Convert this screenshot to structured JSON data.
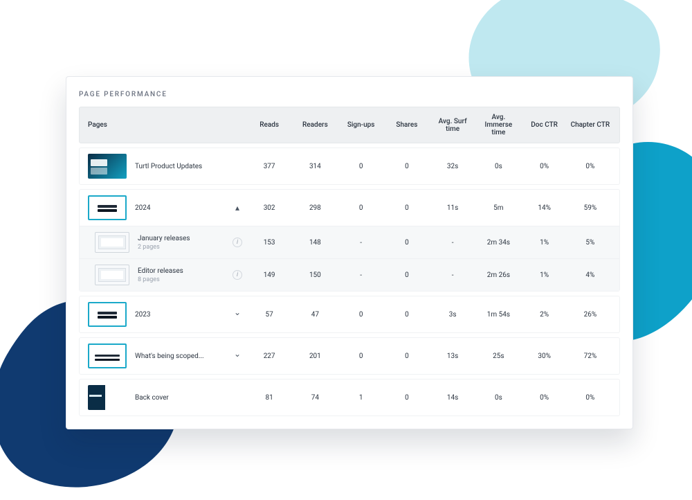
{
  "section_title": "PAGE PERFORMANCE",
  "columns": [
    "Pages",
    "Reads",
    "Readers",
    "Sign-ups",
    "Shares",
    "Avg. Surf time",
    "Avg. Immerse time",
    "Doc CTR",
    "Chapter CTR"
  ],
  "rows": [
    {
      "thumb_class": "cover",
      "title": "Turtl Product Updates",
      "subtitle": "",
      "toggle": "",
      "info": false,
      "vals": [
        "377",
        "314",
        "0",
        "0",
        "32s",
        "0s",
        "0%",
        "0%"
      ],
      "children": []
    },
    {
      "thumb_class": "year",
      "title": "2024",
      "subtitle": "",
      "toggle": "up",
      "info": false,
      "vals": [
        "302",
        "298",
        "0",
        "0",
        "11s",
        "5m",
        "14%",
        "59%"
      ],
      "children": [
        {
          "thumb_class": "pages",
          "title": "January releases",
          "subtitle": "2 pages",
          "info": true,
          "vals": [
            "153",
            "148",
            "-",
            "0",
            "-",
            "2m 34s",
            "1%",
            "5%"
          ]
        },
        {
          "thumb_class": "pages",
          "title": "Editor releases",
          "subtitle": "8 pages",
          "info": true,
          "vals": [
            "149",
            "150",
            "-",
            "0",
            "-",
            "2m 26s",
            "1%",
            "4%"
          ]
        }
      ]
    },
    {
      "thumb_class": "year",
      "title": "2023",
      "subtitle": "",
      "toggle": "down",
      "info": false,
      "vals": [
        "57",
        "47",
        "0",
        "0",
        "3s",
        "1m 54s",
        "2%",
        "26%"
      ],
      "children": []
    },
    {
      "thumb_class": "scoped",
      "title": "What's being scoped...",
      "subtitle": "",
      "toggle": "down",
      "info": false,
      "vals": [
        "227",
        "201",
        "0",
        "0",
        "13s",
        "25s",
        "30%",
        "72%"
      ],
      "children": []
    },
    {
      "thumb_class": "back",
      "title": "Back cover",
      "subtitle": "",
      "toggle": "",
      "info": false,
      "vals": [
        "81",
        "74",
        "1",
        "0",
        "14s",
        "0s",
        "0%",
        "0%"
      ],
      "children": []
    }
  ]
}
